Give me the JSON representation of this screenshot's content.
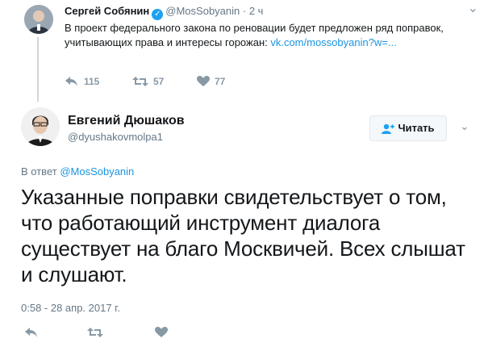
{
  "parent_tweet": {
    "author_name": "Сергей Собянин",
    "handle": "@MosSobyanin",
    "separator": "·",
    "time": "2 ч",
    "text": "В проект федерального закона по реновации будет предложен ряд поправок, учитывающих права и интересы горожан: ",
    "link_text": "vk.com/mossobyanin?w=...",
    "reply_count": "115",
    "retweet_count": "57",
    "like_count": "77",
    "menu_icon": "chevron-down-icon"
  },
  "main_tweet": {
    "author_name": "Евгений Дюшаков",
    "handle": "@dyushakovmolpa1",
    "follow_label": "Читать",
    "reply_prefix": "В ответ ",
    "reply_to": "@MosSobyanin",
    "text": "Указанные поправки свидетельствует о том, что работающий инструмент диалога существует на благо Москвичей. Всех слышат и слушают.",
    "timestamp": "0:58 - 28 апр. 2017 г."
  },
  "colors": {
    "link": "#1b95e0",
    "muted": "#657786",
    "icon": "#8899a6",
    "verified": "#1da1f2"
  }
}
